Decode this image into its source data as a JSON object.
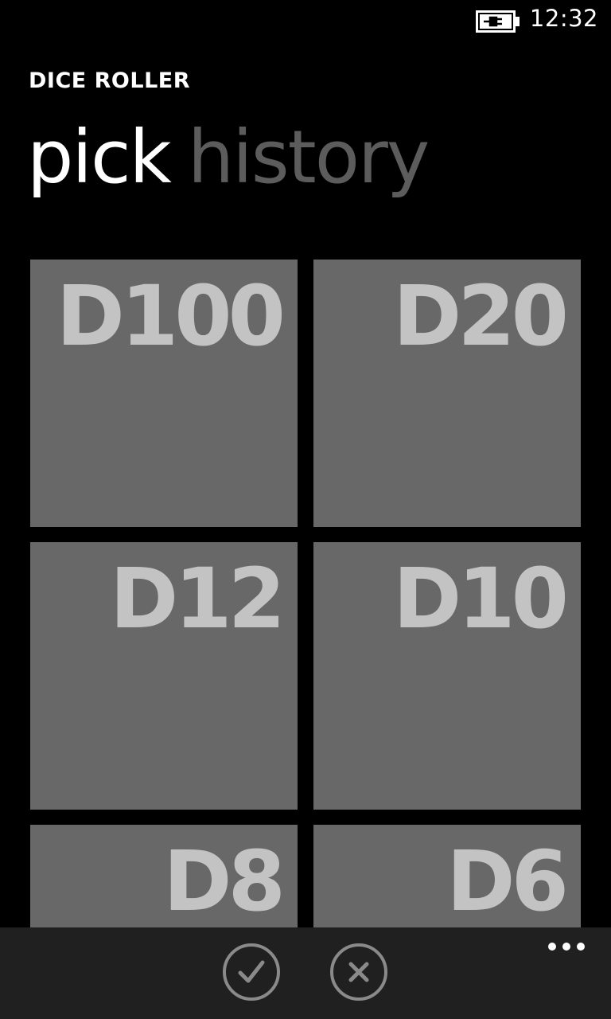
{
  "status_bar": {
    "time": "12:32",
    "battery_icon": "battery-charging-icon"
  },
  "app": {
    "title": "DICE ROLLER"
  },
  "pivot": {
    "tabs": [
      {
        "label": "pick",
        "active": true
      },
      {
        "label": "history",
        "active": false
      }
    ]
  },
  "dice": [
    {
      "label": "D100"
    },
    {
      "label": "D20"
    },
    {
      "label": "D12"
    },
    {
      "label": "D10"
    },
    {
      "label": "D8"
    },
    {
      "label": "D6"
    }
  ],
  "app_bar": {
    "buttons": [
      {
        "icon": "check-icon"
      },
      {
        "icon": "close-icon"
      }
    ],
    "more_icon": "ellipsis-icon"
  },
  "colors": {
    "background": "#000000",
    "tile": "#686868",
    "tile_text": "#c3c3c3",
    "inactive_pivot": "#5c5c5c",
    "app_bar": "#202020"
  }
}
